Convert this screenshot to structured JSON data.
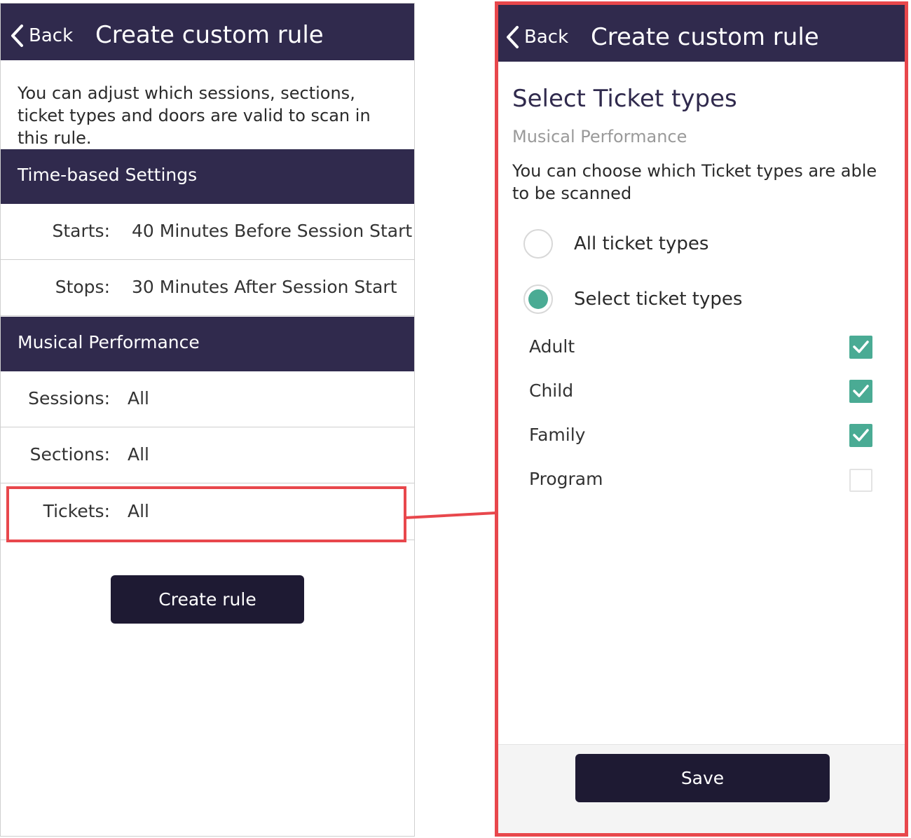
{
  "left_screen": {
    "back_label": "Back",
    "title": "Create custom rule",
    "intro": "You can adjust which sessions, sections, ticket types and doors are valid to scan in this rule.",
    "time_section": {
      "header": "Time-based Settings",
      "starts_label": "Starts:",
      "starts_value": "40 Minutes Before Session Start",
      "stops_label": "Stops:",
      "stops_value": "30 Minutes After Session Start"
    },
    "performance_section": {
      "header": "Musical Performance",
      "sessions_label": "Sessions:",
      "sessions_value": "All",
      "sections_label": "Sections:",
      "sections_value": "All",
      "tickets_label": "Tickets:",
      "tickets_value": "All"
    },
    "create_button": "Create rule"
  },
  "right_screen": {
    "back_label": "Back",
    "title": "Create custom rule",
    "heading": "Select Ticket types",
    "subheading": "Musical Performance",
    "description": "You can choose which Ticket types are able to be scanned",
    "radio_options": [
      {
        "label": "All ticket types",
        "selected": false
      },
      {
        "label": "Select ticket types",
        "selected": true
      }
    ],
    "ticket_types": [
      {
        "label": "Adult",
        "checked": true
      },
      {
        "label": "Child",
        "checked": true
      },
      {
        "label": "Family",
        "checked": true
      },
      {
        "label": "Program",
        "checked": false
      }
    ],
    "save_button": "Save"
  },
  "colors": {
    "header_bg": "#302a4d",
    "button_bg": "#1e1a33",
    "accent_green": "#4aab94",
    "highlight_red": "#e8474c"
  },
  "icons": {
    "back": "chevron-left-icon",
    "check": "checkmark-icon"
  }
}
